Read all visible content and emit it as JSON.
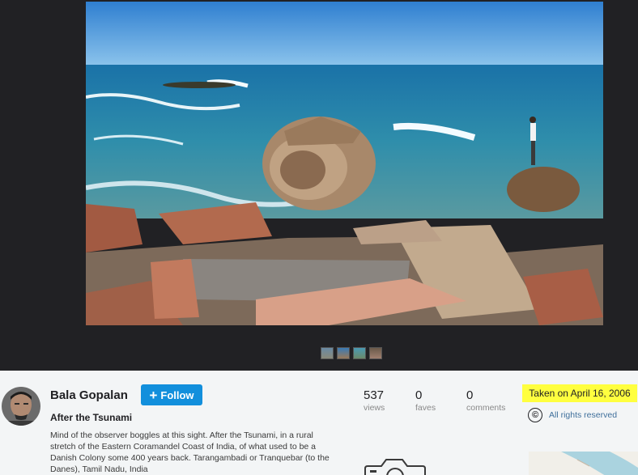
{
  "owner": {
    "name": "Bala Gopalan",
    "follow_label": "Follow"
  },
  "photo": {
    "title": "After the Tsunami",
    "description": "Mind of the observer boggles at this sight. After the Tsunami, in a rural stretch of the Eastern Coramandel Coast of India, of what used to be a Danish Colony some 400 years back. Tarangambadi or Tranquebar (to the Danes), Tamil Nadu, India"
  },
  "stats": {
    "views": {
      "count": "537",
      "label": "views"
    },
    "faves": {
      "count": "0",
      "label": "faves"
    },
    "comments": {
      "count": "0",
      "label": "comments"
    }
  },
  "taken": "Taken on April 16, 2006",
  "rights": {
    "symbol": "©",
    "label": "All rights reserved"
  },
  "colors": {
    "follow": "#128fdc",
    "highlight": "#ffff3f",
    "stage": "#212124",
    "link": "#3f6f9b"
  }
}
